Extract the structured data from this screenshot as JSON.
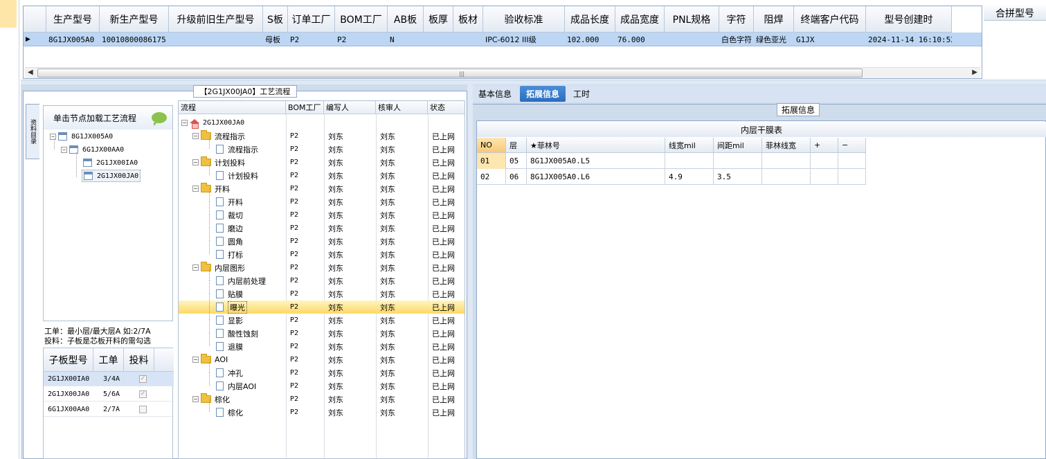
{
  "top_grid": {
    "columns": [
      "生产型号",
      "新生产型号",
      "升级前旧生产型号",
      "S板",
      "订单工厂",
      "BOM工厂",
      "AB板",
      "板厚",
      "板材",
      "验收标准",
      "成品长度",
      "成品宽度",
      "PNL规格",
      "字符",
      "阻焊",
      "终端客户代码",
      "型号创建时"
    ],
    "row": [
      "8G1JX005A0",
      "10010800086175",
      "",
      "母板",
      "P2",
      "P2",
      "N",
      "",
      "",
      "IPC-6012 III级",
      "102.000",
      "76.000",
      "",
      "白色字符",
      "绿色亚光",
      "G1JX",
      "2024-11-14 16:10:52"
    ],
    "merge_header": "合拼型号"
  },
  "process": {
    "panel_title": "【2G1JX00JA0】工艺流程",
    "side_tab": "资料目录",
    "load_hint": "单击节点加载工艺流程",
    "tree": [
      {
        "label": "8G1JX005A0",
        "level": 0
      },
      {
        "label": "6G1JX00AA0",
        "level": 1
      },
      {
        "label": "2G1JX00IA0",
        "level": 2
      },
      {
        "label": "2G1JX00JA0",
        "level": 2
      }
    ],
    "note_line1": "工单：最小层/最大层A 如:2/7A",
    "note_line2": "投料：子板是芯板开料的需勾选",
    "sub_columns": [
      "子板型号",
      "工单",
      "投料"
    ],
    "sub_rows": [
      {
        "model": "2G1JX00IA0",
        "order": "3/4A",
        "feed": "✓"
      },
      {
        "model": "2G1JX00JA0",
        "order": "5/6A",
        "feed": "✓"
      },
      {
        "model": "6G1JX00AA0",
        "order": "2/7A",
        "feed": ""
      }
    ]
  },
  "flow": {
    "columns": [
      "流程",
      "BOM工厂",
      "编写人",
      "核审人",
      "状态"
    ],
    "root": "2G1JX00JA0",
    "rows": [
      {
        "type": "folder",
        "name": "流程指示",
        "bom": "P2",
        "writer": "刘东",
        "checker": "刘东",
        "status": "已上网"
      },
      {
        "type": "doc",
        "name": "流程指示",
        "bom": "P2",
        "writer": "刘东",
        "checker": "刘东",
        "status": "已上网"
      },
      {
        "type": "folder",
        "name": "计划投料",
        "bom": "P2",
        "writer": "刘东",
        "checker": "刘东",
        "status": "已上网"
      },
      {
        "type": "doc",
        "name": "计划投料",
        "bom": "P2",
        "writer": "刘东",
        "checker": "刘东",
        "status": "已上网"
      },
      {
        "type": "folder",
        "name": "开料",
        "bom": "P2",
        "writer": "刘东",
        "checker": "刘东",
        "status": "已上网"
      },
      {
        "type": "doc",
        "name": "开料",
        "bom": "P2",
        "writer": "刘东",
        "checker": "刘东",
        "status": "已上网"
      },
      {
        "type": "doc",
        "name": "裁切",
        "bom": "P2",
        "writer": "刘东",
        "checker": "刘东",
        "status": "已上网"
      },
      {
        "type": "doc",
        "name": "磨边",
        "bom": "P2",
        "writer": "刘东",
        "checker": "刘东",
        "status": "已上网"
      },
      {
        "type": "doc",
        "name": "圆角",
        "bom": "P2",
        "writer": "刘东",
        "checker": "刘东",
        "status": "已上网"
      },
      {
        "type": "doc",
        "name": "打标",
        "bom": "P2",
        "writer": "刘东",
        "checker": "刘东",
        "status": "已上网"
      },
      {
        "type": "folder",
        "name": "内层图形",
        "bom": "P2",
        "writer": "刘东",
        "checker": "刘东",
        "status": "已上网"
      },
      {
        "type": "doc",
        "name": "内层前处理",
        "bom": "P2",
        "writer": "刘东",
        "checker": "刘东",
        "status": "已上网"
      },
      {
        "type": "doc",
        "name": "贴膜",
        "bom": "P2",
        "writer": "刘东",
        "checker": "刘东",
        "status": "已上网"
      },
      {
        "type": "doc",
        "name": "曝光",
        "bom": "P2",
        "writer": "刘东",
        "checker": "刘东",
        "status": "已上网",
        "selected": true
      },
      {
        "type": "doc",
        "name": "显影",
        "bom": "P2",
        "writer": "刘东",
        "checker": "刘东",
        "status": "已上网"
      },
      {
        "type": "doc",
        "name": "酸性蚀刻",
        "bom": "P2",
        "writer": "刘东",
        "checker": "刘东",
        "status": "已上网"
      },
      {
        "type": "doc",
        "name": "退膜",
        "bom": "P2",
        "writer": "刘东",
        "checker": "刘东",
        "status": "已上网"
      },
      {
        "type": "folder",
        "name": "AOI",
        "bom": "P2",
        "writer": "刘东",
        "checker": "刘东",
        "status": "已上网"
      },
      {
        "type": "doc",
        "name": "冲孔",
        "bom": "P2",
        "writer": "刘东",
        "checker": "刘东",
        "status": "已上网"
      },
      {
        "type": "doc",
        "name": "内层AOI",
        "bom": "P2",
        "writer": "刘东",
        "checker": "刘东",
        "status": "已上网"
      },
      {
        "type": "folder",
        "name": "棕化",
        "bom": "P2",
        "writer": "刘东",
        "checker": "刘东",
        "status": "已上网"
      },
      {
        "type": "doc",
        "name": "棕化",
        "bom": "P2",
        "writer": "刘东",
        "checker": "刘东",
        "status": "已上网"
      }
    ]
  },
  "tabs": [
    "基本信息",
    "拓展信息",
    "工时"
  ],
  "ext": {
    "group_title": "拓展信息",
    "table_caption": "内层干膜表",
    "columns": [
      "NO",
      "层",
      "★菲林号",
      "线宽mil",
      "间距mil",
      "菲林线宽",
      "+",
      "−"
    ],
    "rows": [
      [
        "01",
        "05",
        "8G1JX005A0.L5",
        "",
        "",
        "",
        "",
        ""
      ],
      [
        "02",
        "06",
        "8G1JX005A0.L6",
        "4.9",
        "3.5",
        "",
        "",
        ""
      ]
    ]
  },
  "colors": {
    "selected_row": "#bcd6f4",
    "accent": "#2a6cbf",
    "highlight": "#ffd966",
    "panel": "#cfdcec"
  }
}
